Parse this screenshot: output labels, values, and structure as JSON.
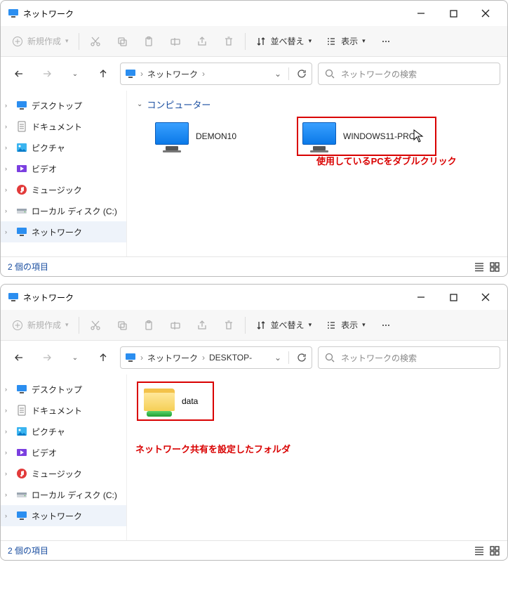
{
  "window1": {
    "title": "ネットワーク",
    "cmdbar": {
      "new": "新規作成",
      "sort": "並べ替え",
      "view": "表示"
    },
    "breadcrumb": [
      "ネットワーク"
    ],
    "search_placeholder": "ネットワークの検索",
    "nav": {
      "desktop": "デスクトップ",
      "documents": "ドキュメント",
      "pictures": "ピクチャ",
      "videos": "ビデオ",
      "music": "ミュージック",
      "localdisk": "ローカル ディスク (C:)",
      "network": "ネットワーク"
    },
    "group": "コンピューター",
    "items": {
      "demon": "DEMON10",
      "winpro": "WINDOWS11-PRO"
    },
    "callout": "使用しているPCをダブルクリック",
    "status": "2 個の項目"
  },
  "window2": {
    "title": "ネットワーク",
    "cmdbar": {
      "new": "新規作成",
      "sort": "並べ替え",
      "view": "表示"
    },
    "breadcrumb": [
      "ネットワーク",
      "DESKTOP-"
    ],
    "search_placeholder": "ネットワークの検索",
    "nav": {
      "desktop": "デスクトップ",
      "documents": "ドキュメント",
      "pictures": "ピクチャ",
      "videos": "ビデオ",
      "music": "ミュージック",
      "localdisk": "ローカル ディスク (C:)",
      "network": "ネットワーク"
    },
    "items": {
      "data": "data"
    },
    "callout": "ネットワーク共有を設定したフォルダ",
    "status": "2 個の項目"
  }
}
